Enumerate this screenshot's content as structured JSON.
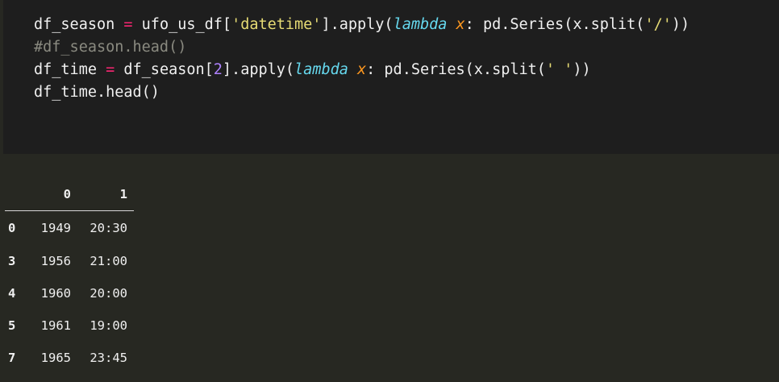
{
  "code_cell": {
    "line1": {
      "a": "df_season ",
      "op": "=",
      "b": " ufo_us_df[",
      "str": "'datetime'",
      "c": "].apply(",
      "kw": "lambda",
      "d": " ",
      "param": "x",
      "e": ": pd.Series(x.split(",
      "str2": "'/'",
      "f": "))"
    },
    "line2": {
      "comment": "#df_season.head()"
    },
    "line3": {
      "a": "df_time ",
      "op": "=",
      "b": " df_season[",
      "num": "2",
      "c": "].apply(",
      "kw": "lambda",
      "d": " ",
      "param": "x",
      "e": ": pd.Series(x.split(",
      "str": "' '",
      "f": "))"
    },
    "line4": {
      "text": "df_time.head()"
    }
  },
  "output": {
    "columns": [
      "",
      "0",
      "1"
    ],
    "rows": [
      {
        "index": "0",
        "c0": "1949",
        "c1": "20:30"
      },
      {
        "index": "3",
        "c0": "1956",
        "c1": "21:00"
      },
      {
        "index": "4",
        "c0": "1960",
        "c1": "20:00"
      },
      {
        "index": "5",
        "c0": "1961",
        "c1": "19:00"
      },
      {
        "index": "7",
        "c0": "1965",
        "c1": "23:45"
      }
    ]
  }
}
